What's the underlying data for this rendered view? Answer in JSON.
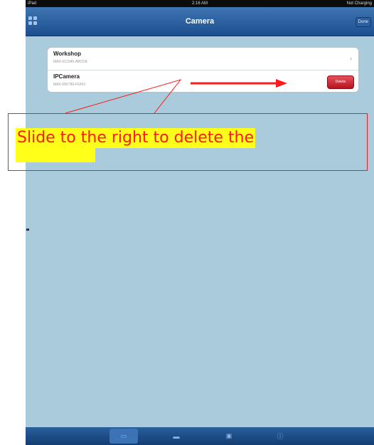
{
  "status_bar": {
    "carrier": "iPad",
    "time": "2:16 AM",
    "battery": "Not Charging"
  },
  "nav": {
    "title": "Camera",
    "right_button": "Done",
    "left_icon": "grid-icon"
  },
  "cameras": [
    {
      "name": "Workshop",
      "id": "MAX-012345-ABCDE",
      "accessory": "chevron-right-icon"
    },
    {
      "name": "IPCamera",
      "id": "MAX-056789-FGHIJ",
      "action": "Delete"
    }
  ],
  "tabs": [
    {
      "name": "camera-tab",
      "icon": "video-camera-icon",
      "glyph": "▭",
      "active": true
    },
    {
      "name": "photos-tab",
      "icon": "photo-icon",
      "glyph": "▬",
      "active": false
    },
    {
      "name": "scenes-tab",
      "icon": "frame-icon",
      "glyph": "▣",
      "active": false
    },
    {
      "name": "info-tab",
      "icon": "info-icon",
      "glyph": "ⓘ",
      "active": false
    }
  ],
  "annotation": {
    "text": "Slide to the right to delete the",
    "text_color": "#ff1a1a",
    "highlight_color": "#ffff1a"
  },
  "colors": {
    "nav": "#2a5f9c",
    "background": "#a9cbdc",
    "delete": "#cf2a35"
  }
}
